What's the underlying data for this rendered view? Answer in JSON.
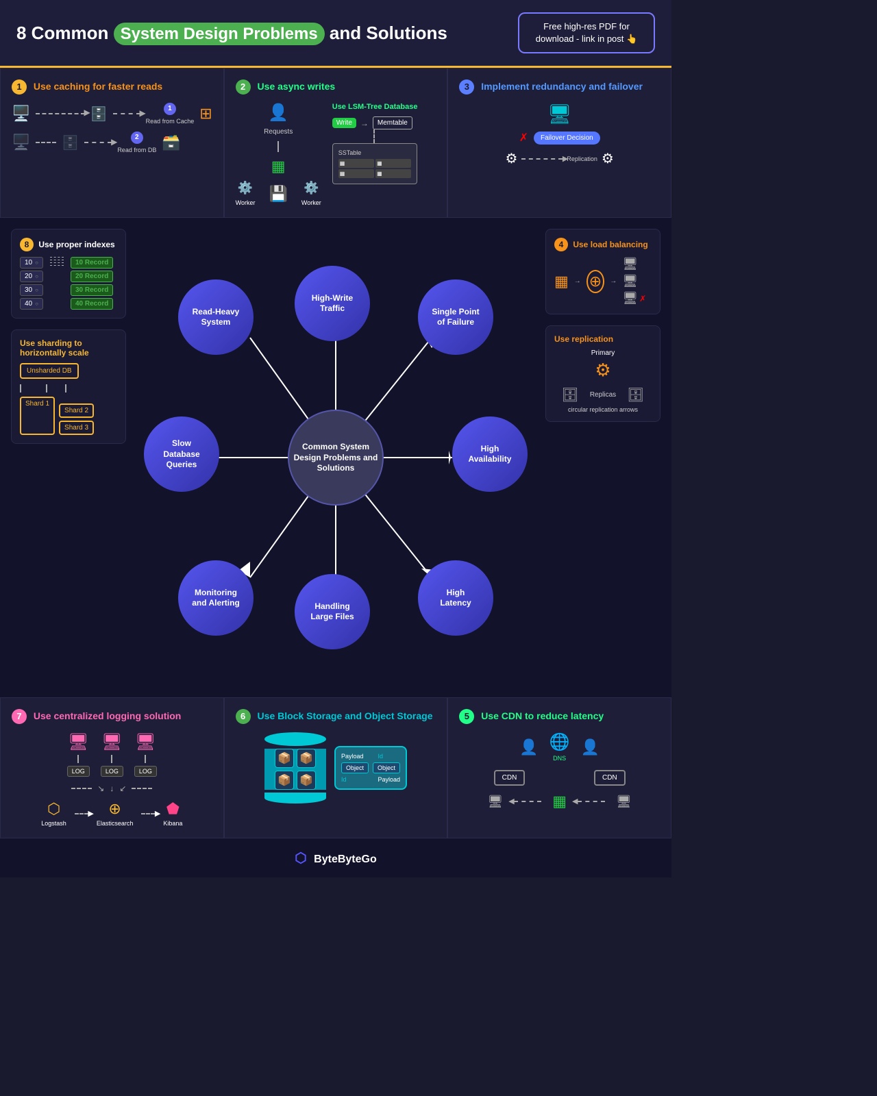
{
  "header": {
    "title_pre": "8 Common",
    "title_highlight": "System Design Problems",
    "title_post": "and Solutions",
    "cta_text": "Free high-res PDF for download - link in post",
    "cta_icon": "👆"
  },
  "panel1": {
    "num": "1",
    "title": "Use caching for faster reads",
    "step1": "Read from Cache",
    "step2": "Read from DB"
  },
  "panel2": {
    "num": "2",
    "title": "Use async writes",
    "requests": "Requests",
    "worker1": "Worker",
    "worker2": "Worker",
    "lsm_title": "Use LSM-Tree Database",
    "write": "Write",
    "memtable": "Memtable",
    "sstable": "SSTable"
  },
  "panel3": {
    "num": "3",
    "title": "Implement redundancy and failover",
    "failover": "Failover Decision",
    "replication": "Replication"
  },
  "center": {
    "title": "Common System Design Problems and Solutions",
    "nodes": [
      "Read-Heavy System",
      "High-Write Traffic",
      "Single Point of Failure",
      "Slow Database Queries",
      "High Availability",
      "Monitoring and Alerting",
      "Handling Large Files",
      "High Latency"
    ]
  },
  "sol8": {
    "num": "8",
    "title": "Use proper indexes",
    "keys": [
      "10",
      "20",
      "30",
      "40"
    ],
    "records": [
      "10 Record",
      "20 Record",
      "30 Record",
      "40 Record"
    ]
  },
  "sol_sharding": {
    "title": "Use sharding to horizontally scale",
    "unsharded": "Unsharded DB",
    "shards": [
      "Shard 1",
      "Shard 2",
      "Shard 3"
    ]
  },
  "sol4": {
    "num": "4",
    "title": "Use load balancing"
  },
  "sol_replication": {
    "title": "Use replication",
    "primary": "Primary",
    "replicas": "Replicas"
  },
  "panel7": {
    "num": "7",
    "title": "Use centralized logging solution",
    "logstash": "Logstash",
    "elasticsearch": "Elasticsearch",
    "kibana": "Kibana"
  },
  "panel6": {
    "num": "6",
    "title": "Use Block Storage and Object Storage",
    "payload1": "Payload",
    "id1": "Id",
    "object1": "Object",
    "object2": "Object",
    "id2": "Id",
    "payload2": "Payload"
  },
  "panel5": {
    "num": "5",
    "title": "Use CDN to reduce latency",
    "dns": "DNS",
    "cdn1": "CDN",
    "cdn2": "CDN"
  },
  "footer": {
    "logo": "⬡ ByteByteGo"
  }
}
